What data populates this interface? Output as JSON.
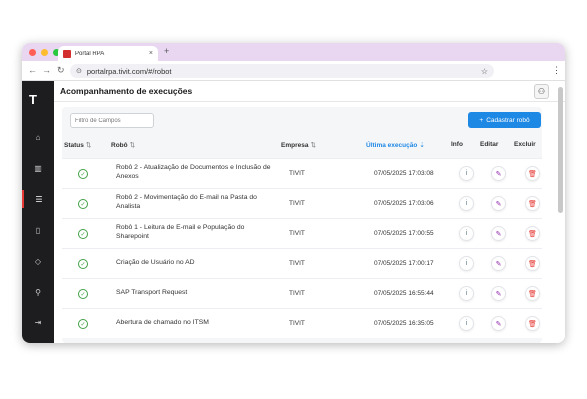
{
  "browser": {
    "tab_title": "Portal RPA",
    "tab_close": "×",
    "new_tab": "+",
    "url": "portalrpa.tivit.com/#/robot",
    "back": "←",
    "forward": "→",
    "reload": "↻",
    "site_info": "⊙",
    "bookmark": "☆",
    "menu": "⋮"
  },
  "sidebar": {
    "logo": "T",
    "items": [
      {
        "icon": "home-icon",
        "glyph": "⌂"
      },
      {
        "icon": "chart-icon",
        "glyph": "▥"
      },
      {
        "icon": "list-icon",
        "glyph": "☰"
      },
      {
        "icon": "document-icon",
        "glyph": "▯"
      },
      {
        "icon": "tag-icon",
        "glyph": "◇"
      },
      {
        "icon": "search-icon",
        "glyph": "⚲"
      },
      {
        "icon": "logout-icon",
        "glyph": "⇥"
      }
    ]
  },
  "header": {
    "title": "Acompanhamento de execuções",
    "user_glyph": "⚇"
  },
  "toolbar": {
    "filter_placeholder": "Filtro de Campos",
    "add_label": "Cadastrar robô",
    "add_glyph": "+"
  },
  "table": {
    "columns": {
      "status": "Status",
      "robo": "Robô",
      "empresa": "Empresa",
      "ultima": "Última execução",
      "info": "Info",
      "editar": "Editar",
      "excluir": "Excluir"
    },
    "sort_glyph": "⇅",
    "sort_active_glyph": "⇣",
    "action_glyphs": {
      "info": "i",
      "edit": "✎",
      "delete": "🗑"
    },
    "status_glyph": "✓",
    "rows": [
      {
        "robot": "Robô 2 - Atualização de Documentos e Inclusão de Anexos",
        "empresa": "TIVIT",
        "ultima": "07/05/2025 17:03:08"
      },
      {
        "robot": "Robô 2 - Movimentação do E-mail na Pasta do Analista",
        "empresa": "TIVIT",
        "ultima": "07/05/2025 17:03:06"
      },
      {
        "robot": "Robô 1 - Leitura de E-mail e População do Sharepoint",
        "empresa": "TIVIT",
        "ultima": "07/05/2025 17:00:55"
      },
      {
        "robot": "Criação de Usuário no AD",
        "empresa": "TIVIT",
        "ultima": "07/05/2025 17:00:17"
      },
      {
        "robot": "SAP Transport Request",
        "empresa": "TIVIT",
        "ultima": "07/05/2025 16:55:44"
      },
      {
        "robot": "Abertura de chamado no ITSM",
        "empresa": "TIVIT",
        "ultima": "07/05/2025 16:35:05"
      }
    ]
  },
  "colors": {
    "sidebar_bg": "#1d1d1f",
    "accent_blue": "#1e88e5",
    "status_green": "#43a047",
    "delete_red": "#e53935",
    "edit_purple": "#8e24aa",
    "tabbar": "#e9d7f2"
  }
}
